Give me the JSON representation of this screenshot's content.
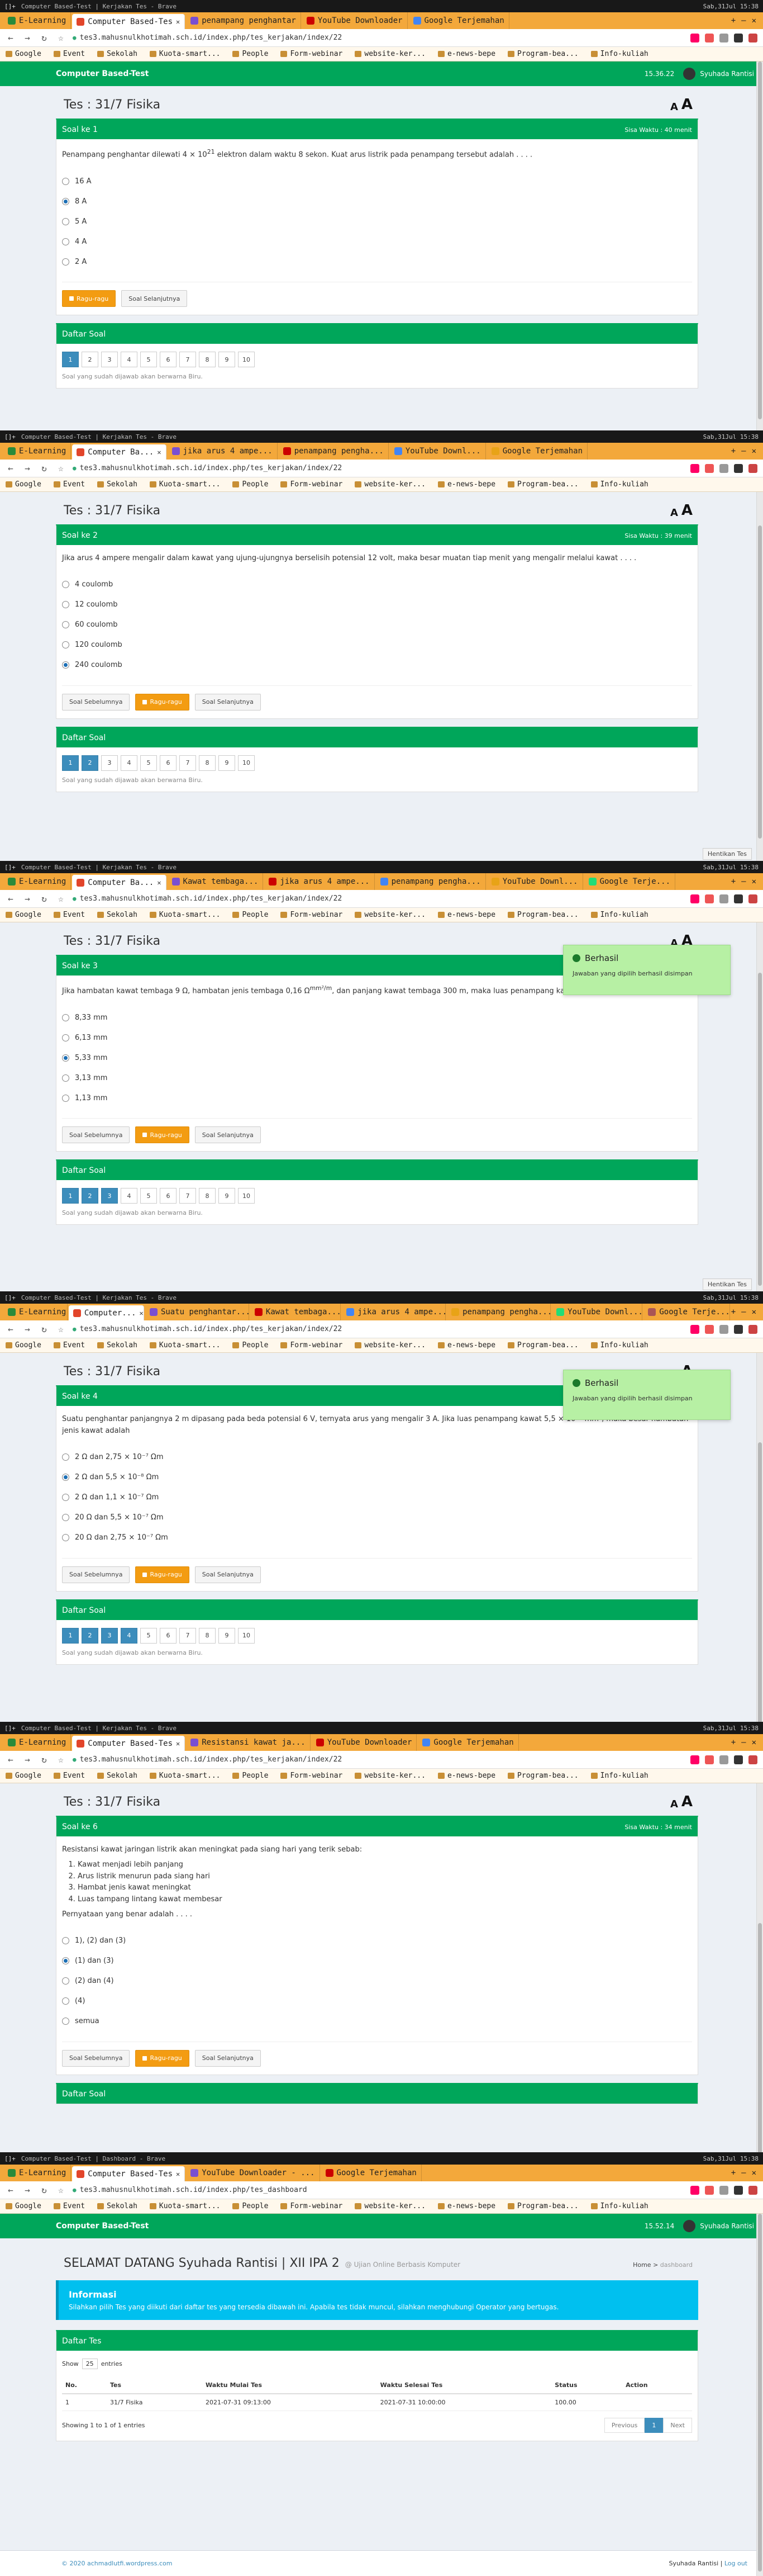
{
  "accent": "#00a65a",
  "browser": {
    "sys_title": "Computer Based-Test | Kerjakan Tes - Brave",
    "sys_title_dash": "Computer Based-Test | Dashboard - Brave",
    "sys_time": "Sab,31Jul 15:38",
    "url_test": "tes3.mahusnulkhotimah.sch.id/index.php/tes_kerjakan/index/22",
    "url_dash": "tes3.mahusnulkhotimah.sch.id/index.php/tes_dashboard",
    "bookmarks": [
      "Google",
      "Event",
      "Sekolah",
      "Kuota-smart...",
      "People",
      "Form-webinar",
      "website-ker...",
      "e-news-bepe",
      "Program-bea...",
      "Info-kuliah"
    ]
  },
  "app": {
    "brand": "Computer Based-Test",
    "user": "Syuhada Rantisi",
    "test_title": "Tes : 31/7 Fisika",
    "font_small": "A",
    "font_large": "A",
    "btn_prev": "Soal Sebelumnya",
    "btn_ragu": "Ragu-ragu",
    "btn_next": "Soal Selanjutnya",
    "daftar_soal": "Daftar Soal",
    "daftar_note": "Soal yang sudah dijawab akan berwarna Biru.",
    "hentikan": "Hentikan Tes",
    "toast_title": "Berhasil",
    "toast_msg": "Jawaban yang dipilih berhasil disimpan",
    "numbers": [
      "1",
      "2",
      "3",
      "4",
      "5",
      "6",
      "7",
      "8",
      "9",
      "10"
    ]
  },
  "screens": [
    {
      "tabs": [
        "E-Learning",
        "Computer Based-Tes",
        "penampang penghantar",
        "YouTube Downloader",
        "Google Terjemahan"
      ],
      "time": "15.36.22",
      "soal": "Soal ke 1",
      "sisa": "Sisa Waktu : 40 menit",
      "question": "Penampang penghantar dilewati 4 × 10",
      "question_sup": "21",
      "question_tail": " elektron dalam waktu 8 sekon. Kuat arus listrik pada penampang tersebut adalah . . . .",
      "options": [
        "16 A",
        "8 A",
        "5 A",
        "4 A",
        "2 A"
      ],
      "selected": 1,
      "answered": 1
    },
    {
      "tabs": [
        "E-Learning",
        "Computer Ba...",
        "jika arus 4 ampe...",
        "penampang pengha...",
        "YouTube Downl...",
        "Google Terjemahan"
      ],
      "soal": "Soal ke 2",
      "sisa": "Sisa Waktu : 39 menit",
      "question": "Jika arus 4 ampere mengalir dalam kawat yang ujung-ujungnya berselisih potensial 12 volt, maka besar muatan tiap menit yang mengalir melalui kawat . . . .",
      "options": [
        "4 coulomb",
        "12 coulomb",
        "60 coulomb",
        "120 coulomb",
        "240 coulomb"
      ],
      "selected": 4,
      "answered": 2
    },
    {
      "tabs": [
        "E-Learning",
        "Computer Ba...",
        "Kawat tembaga...",
        "jika arus 4 ampe...",
        "penampang pengha...",
        "YouTube Downl...",
        "Google Terje..."
      ],
      "soal": "Soal ke 3",
      "sisa": "Sisa Waktu : 38 menit",
      "question": "Jika hambatan kawat tembaga 9 Ω, hambatan jenis tembaga 0,16 Ω",
      "question_sup": "mm²/m",
      "question_tail": ", dan panjang kawat tembaga 300 m, maka luas penampang kawat adalah . . . .",
      "options": [
        "8,33 mm",
        "6,13 mm",
        "5,33 mm",
        "3,13 mm",
        "1,13 mm"
      ],
      "selected": 2,
      "answered": 3
    },
    {
      "tabs": [
        "E-Learning",
        "Computer...",
        "Suatu penghantar...",
        "Kawat tembaga...",
        "jika arus 4 ampe...",
        "penampang pengha...",
        "YouTube Downl...",
        "Google Terje..."
      ],
      "soal": "Soal ke 4",
      "sisa": "Sisa Waktu : 37 menit",
      "question": "Suatu penghantar panjangnya 2 m dipasang pada beda potensial 6 V, ternyata arus yang mengalir 3 A. Jika luas penampang kawat 5,5 × 10⁻² mm², maka besar hambatan jenis kawat adalah",
      "options": [
        "2 Ω dan 2,75 × 10⁻⁷ Ωm",
        "2 Ω dan 5,5 × 10⁻⁸ Ωm",
        "2 Ω dan 1,1 × 10⁻⁷ Ωm",
        "20 Ω dan 5,5 × 10⁻⁷ Ωm",
        "20 Ω dan 2,75 × 10⁻⁷ Ωm"
      ],
      "selected": 1,
      "answered": 4
    },
    {
      "tabs": [
        "E-Learning",
        "Computer Based-Tes",
        "Resistansi kawat ja...",
        "YouTube Downloader",
        "Google Terjemahan"
      ],
      "soal": "Soal ke 6",
      "sisa": "Sisa Waktu : 34 menit",
      "question": "Resistansi kawat jaringan listrik akan meningkat pada siang hari yang terik sebab:",
      "list": [
        "Kawat menjadi lebih panjang",
        "Arus listrik menurun pada siang hari",
        "Hambat jenis kawat meningkat",
        "Luas tampang lintang kawat membesar"
      ],
      "question_after": "Pernyataan yang benar adalah . . . .",
      "options": [
        "1), (2) dan (3)",
        "(1) dan (3)",
        "(2) dan (4)",
        "(4)",
        "semua"
      ],
      "selected": 1
    }
  ],
  "dashboard": {
    "tabs": [
      "E-Learning",
      "Computer Based-Tes",
      "YouTube Downloader - ...",
      "Google Terjemahan"
    ],
    "time": "15.52.14",
    "welcome": "SELAMAT DATANG Syuhada Rantisi | XII IPA 2",
    "welcome_sub": "@ Ujian Online Berbasis Komputer",
    "crumb_home": "Home",
    "crumb_cur": "dashboard",
    "info_title": "Informasi",
    "info_body": "Silahkan pilih Tes yang diikuti dari daftar tes yang tersedia dibawah ini. Apabila tes tidak muncul, silahkan menghubungi Operator yang bertugas.",
    "box_title": "Daftar Tes",
    "show_label": "Show",
    "show_value": "25",
    "entries_label": "entries",
    "columns": [
      "No.",
      "Tes",
      "Waktu Mulai Tes",
      "Waktu Selesai Tes",
      "Status",
      "Action"
    ],
    "rows": [
      [
        "1",
        "31/7 Fisika",
        "2021-07-31 09:13:00",
        "2021-07-31 10:00:00",
        "100.00",
        ""
      ]
    ],
    "showing": "Showing 1 to 1 of 1 entries",
    "prev": "Previous",
    "page": "1",
    "next": "Next",
    "footer_left": "© 2020 achmadlutfi.wordpress.com",
    "footer_user": "Syuhada Rantisi",
    "footer_logout": "Log out"
  }
}
